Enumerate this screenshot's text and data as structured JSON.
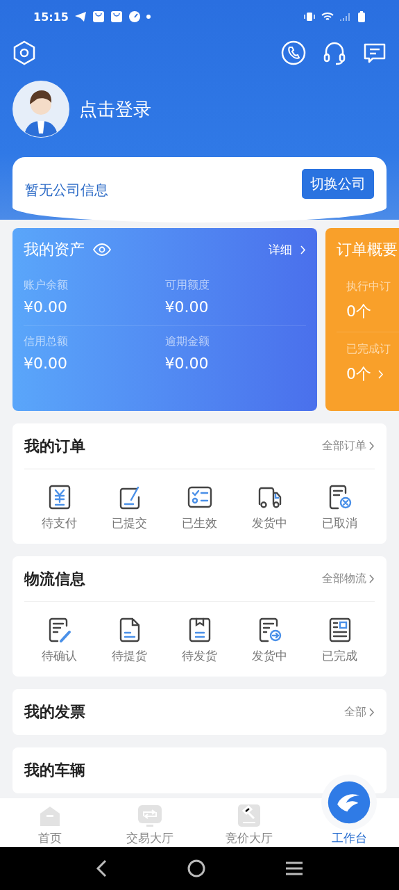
{
  "status_bar": {
    "time": "15:15"
  },
  "profile": {
    "login_label": "点击登录"
  },
  "company": {
    "text": "暂无公司信息",
    "button": "切换公司"
  },
  "assets": {
    "title": "我的资产",
    "detail_link": "详细",
    "items": [
      {
        "label": "账户余额",
        "value": "¥0.00"
      },
      {
        "label": "可用额度",
        "value": "¥0.00"
      },
      {
        "label": "信用总额",
        "value": "¥0.00"
      },
      {
        "label": "逾期金额",
        "value": "¥0.00"
      }
    ]
  },
  "order_summary": {
    "title": "订单概要",
    "items": [
      {
        "label": "执行中订",
        "value": "0个"
      },
      {
        "label": "已完成订",
        "value": "0个"
      }
    ]
  },
  "sections": [
    {
      "title": "我的订单",
      "link": "全部订单",
      "items": [
        {
          "label": "待支付"
        },
        {
          "label": "已提交"
        },
        {
          "label": "已生效"
        },
        {
          "label": "发货中"
        },
        {
          "label": "已取消"
        }
      ]
    },
    {
      "title": "物流信息",
      "link": "全部物流",
      "items": [
        {
          "label": "待确认"
        },
        {
          "label": "待提货"
        },
        {
          "label": "待发货"
        },
        {
          "label": "发货中"
        },
        {
          "label": "已完成"
        }
      ]
    },
    {
      "title": "我的发票",
      "link": "全部"
    },
    {
      "title": "我的车辆"
    }
  ],
  "tab_bar": [
    {
      "label": "首页",
      "selected": false
    },
    {
      "label": "交易大厅",
      "selected": false
    },
    {
      "label": "竞价大厅",
      "selected": false
    },
    {
      "label": "工作台",
      "selected": true
    }
  ]
}
